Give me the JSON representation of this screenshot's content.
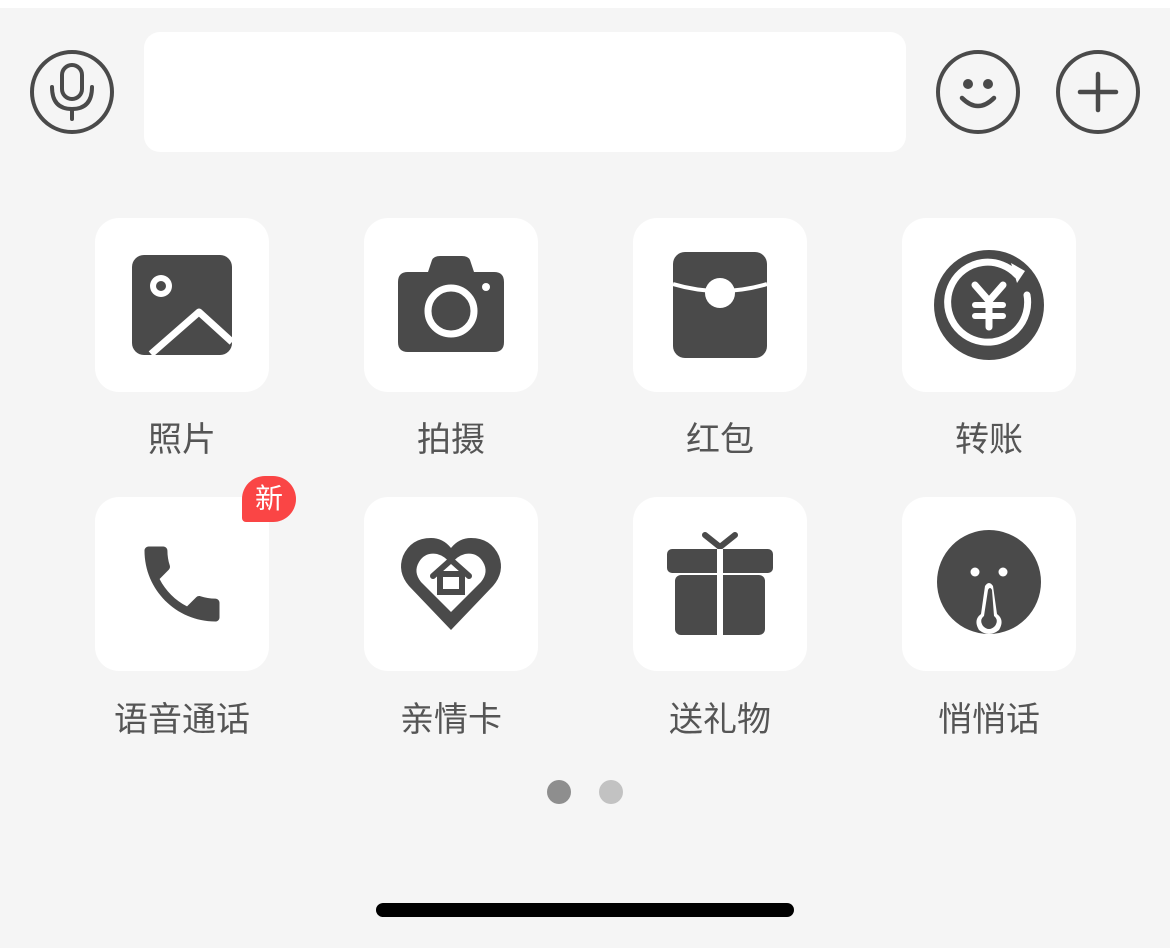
{
  "input_bar": {
    "voice_icon": "microphone-icon",
    "emoji_icon": "smiley-icon",
    "more_icon": "plus-icon",
    "message_value": ""
  },
  "actions": [
    {
      "label": "照片",
      "icon": "photo-icon"
    },
    {
      "label": "拍摄",
      "icon": "camera-icon"
    },
    {
      "label": "红包",
      "icon": "red-packet-icon"
    },
    {
      "label": "转账",
      "icon": "transfer-icon"
    },
    {
      "label": "语音通话",
      "icon": "phone-icon",
      "badge": "新"
    },
    {
      "label": "亲情卡",
      "icon": "family-card-icon"
    },
    {
      "label": "送礼物",
      "icon": "gift-icon"
    },
    {
      "label": "悄悄话",
      "icon": "whisper-icon"
    }
  ],
  "pager": {
    "pages": 2,
    "current": 1
  },
  "colors": {
    "panel_bg": "#f5f5f5",
    "icon": "#4a4a4a",
    "label": "#555555",
    "badge": "#fa4545",
    "dot_active": "#8e8e8e",
    "dot_inactive": "#c2c2c2"
  }
}
